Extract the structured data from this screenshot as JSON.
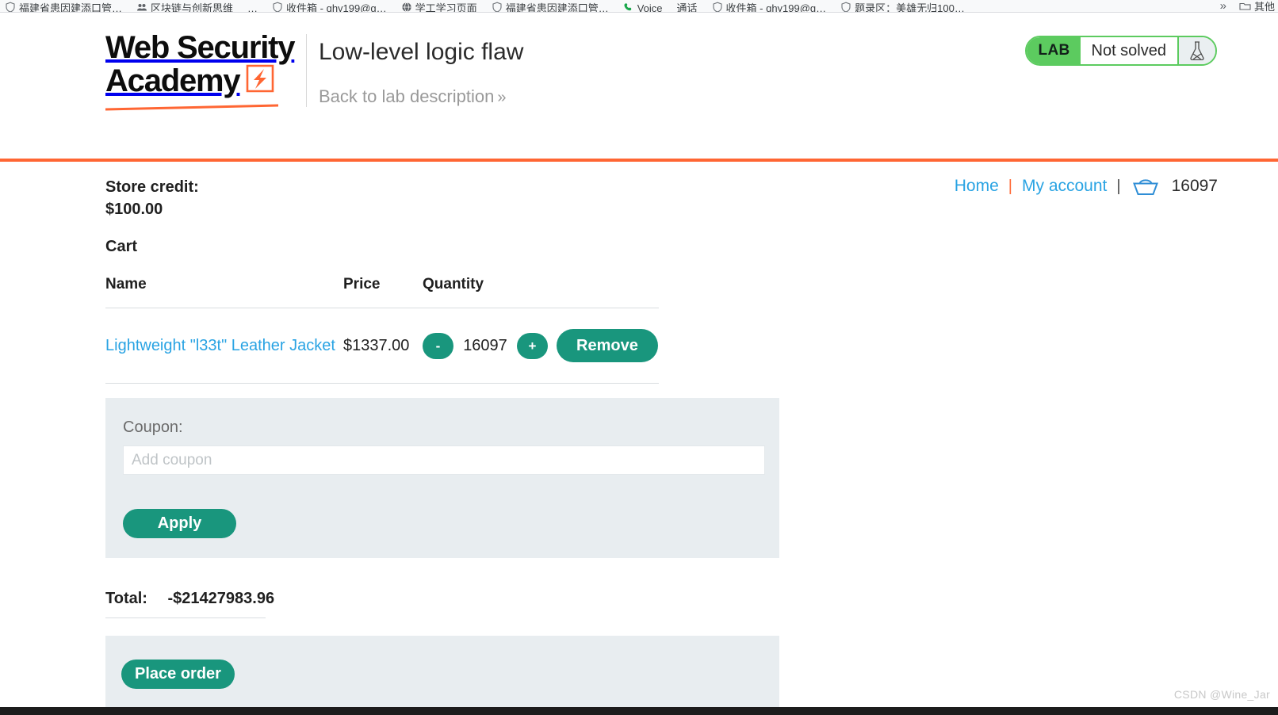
{
  "browser": {
    "bookmarks": [
      {
        "icon": "shield-icon",
        "label": "福建省患因建添口管…"
      },
      {
        "icon": "people-icon",
        "label": "区块链与创新思维"
      },
      {
        "icon": "overflow-icon",
        "label": "…"
      },
      {
        "icon": "shield-icon",
        "label": "收件箱 - qhy199@g…"
      },
      {
        "icon": "globe-icon",
        "label": "学工学习页面"
      },
      {
        "icon": "shield-icon",
        "label": "福建省患因建添口管…"
      },
      {
        "icon": "phone-icon",
        "label": "Voice"
      },
      {
        "icon": "text-icon",
        "label": "通话"
      },
      {
        "icon": "shield-icon",
        "label": "收件箱 - qhy199@g…"
      },
      {
        "icon": "shield-icon",
        "label": "题录区：美雄无归100…"
      }
    ],
    "overflow_label": "»",
    "other_bookmarks_label": "其他"
  },
  "header": {
    "logo_line1": "Web Security",
    "logo_line2": "Academy",
    "lab_title": "Low-level logic flaw",
    "back_link": "Back to lab description",
    "back_arrows": "»",
    "status": {
      "tag": "LAB",
      "state": "Not solved",
      "flask_icon": "flask-icon"
    }
  },
  "nav": {
    "home": "Home",
    "my_account": "My account",
    "separator": "|",
    "cart_icon": "basket-icon",
    "cart_count": "16097"
  },
  "store": {
    "credit_label": "Store credit:",
    "credit_value": "$100.00",
    "cart_heading": "Cart"
  },
  "cart": {
    "columns": [
      "Name",
      "Price",
      "Quantity"
    ],
    "rows": [
      {
        "name": "Lightweight \"l33t\" Leather Jacket",
        "price": "$1337.00",
        "decrement": "-",
        "quantity": "16097",
        "increment": "+",
        "remove": "Remove"
      }
    ]
  },
  "coupon": {
    "label": "Coupon:",
    "placeholder": "Add coupon",
    "value": "",
    "apply_label": "Apply"
  },
  "totals": {
    "label": "Total:",
    "amount": "-$21427983.96"
  },
  "order": {
    "place_order_label": "Place order"
  },
  "watermark": "CSDN @Wine_Jar",
  "colors": {
    "accent_orange": "#ff6633",
    "brand_green": "#19967d",
    "lab_green": "#5ccb5f",
    "link_blue": "#29a3e3",
    "panel_gray": "#e8edf0"
  }
}
